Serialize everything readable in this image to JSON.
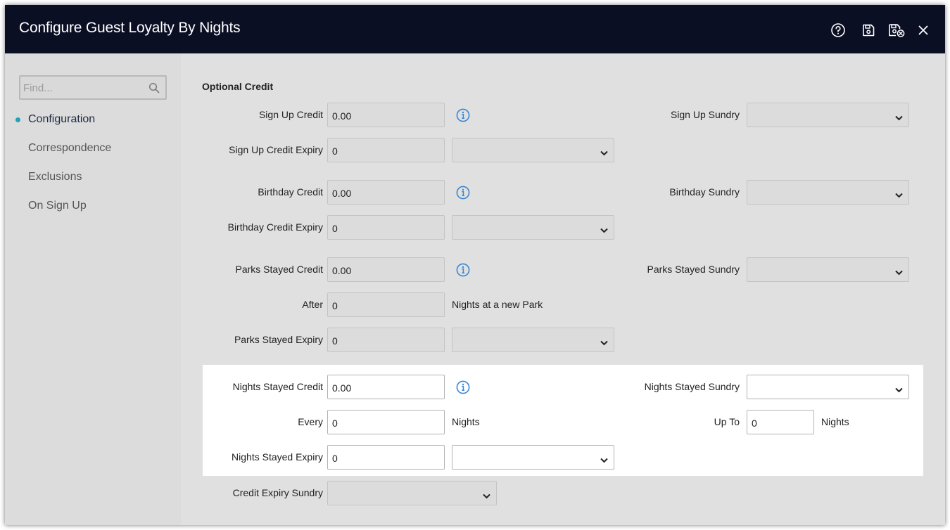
{
  "window": {
    "title": "Configure Guest Loyalty By Nights"
  },
  "titlebar_icons": [
    "help-icon",
    "save-icon",
    "save-and-close-icon",
    "close-icon"
  ],
  "sidebar": {
    "search_placeholder": "Find...",
    "items": [
      {
        "label": "Configuration",
        "active": true
      },
      {
        "label": "Correspondence",
        "active": false
      },
      {
        "label": "Exclusions",
        "active": false
      },
      {
        "label": "On Sign Up",
        "active": false
      }
    ]
  },
  "section": {
    "title": "Optional Credit"
  },
  "fields": {
    "sign_up_credit": {
      "label": "Sign Up Credit",
      "value": "0.00"
    },
    "sign_up_sundry": {
      "label": "Sign Up Sundry",
      "value": ""
    },
    "sign_up_credit_expiry": {
      "label": "Sign Up Credit Expiry",
      "value": "0",
      "unit": ""
    },
    "birthday_credit": {
      "label": "Birthday Credit",
      "value": "0.00"
    },
    "birthday_sundry": {
      "label": "Birthday Sundry",
      "value": ""
    },
    "birthday_credit_expiry": {
      "label": "Birthday Credit Expiry",
      "value": "0",
      "unit": ""
    },
    "parks_stayed_credit": {
      "label": "Parks Stayed Credit",
      "value": "0.00"
    },
    "parks_stayed_sundry": {
      "label": "Parks Stayed Sundry",
      "value": ""
    },
    "after": {
      "label": "After",
      "value": "0",
      "suffix": "Nights at a new Park"
    },
    "parks_stayed_expiry": {
      "label": "Parks Stayed Expiry",
      "value": "0",
      "unit": ""
    },
    "nights_stayed_credit": {
      "label": "Nights Stayed Credit",
      "value": "0.00"
    },
    "nights_stayed_sundry": {
      "label": "Nights Stayed Sundry",
      "value": ""
    },
    "every": {
      "label": "Every",
      "value": "0",
      "suffix": "Nights"
    },
    "up_to": {
      "label": "Up To",
      "value": "0",
      "suffix": "Nights"
    },
    "nights_stayed_expiry": {
      "label": "Nights Stayed Expiry",
      "value": "0",
      "unit": ""
    },
    "credit_expiry_sundry": {
      "label": "Credit Expiry Sundry",
      "value": ""
    }
  },
  "colors": {
    "titlebar": "#0b0f24",
    "accent": "#20a3b8",
    "info_icon": "#3a86d6"
  }
}
